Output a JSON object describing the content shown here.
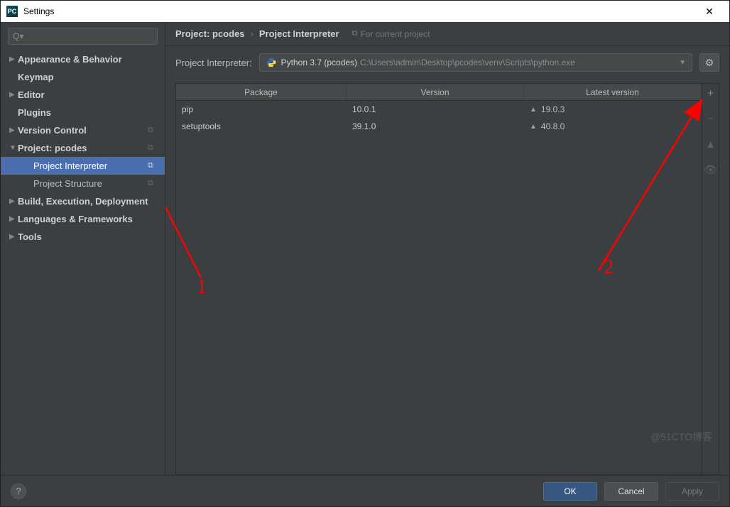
{
  "window_title": "Settings",
  "sidebar": {
    "search_placeholder": "",
    "items": [
      {
        "label": "Appearance & Behavior",
        "arrow": "▶",
        "bold": true
      },
      {
        "label": "Keymap",
        "arrow": "",
        "bold": true
      },
      {
        "label": "Editor",
        "arrow": "▶",
        "bold": true
      },
      {
        "label": "Plugins",
        "arrow": "",
        "bold": true
      },
      {
        "label": "Version Control",
        "arrow": "▶",
        "bold": true,
        "copy": true
      },
      {
        "label": "Project: pcodes",
        "arrow": "▼",
        "bold": true,
        "copy": true
      },
      {
        "label": "Project Interpreter",
        "child": true,
        "selected": true,
        "copy": true
      },
      {
        "label": "Project Structure",
        "child": true,
        "copy": true
      },
      {
        "label": "Build, Execution, Deployment",
        "arrow": "▶",
        "bold": true
      },
      {
        "label": "Languages & Frameworks",
        "arrow": "▶",
        "bold": true
      },
      {
        "label": "Tools",
        "arrow": "▶",
        "bold": true
      }
    ]
  },
  "breadcrumb": {
    "part1": "Project: pcodes",
    "part2": "Project Interpreter",
    "for_current": "For current project"
  },
  "interpreter": {
    "label": "Project Interpreter:",
    "name": "Python 3.7 (pcodes)",
    "path": "C:\\Users\\admin\\Desktop\\pcodes\\venv\\Scripts\\python.exe"
  },
  "table": {
    "headers": {
      "pkg": "Package",
      "ver": "Version",
      "lat": "Latest version"
    },
    "rows": [
      {
        "pkg": "pip",
        "ver": "10.0.1",
        "lat": "19.0.3",
        "upgrade": true
      },
      {
        "pkg": "setuptools",
        "ver": "39.1.0",
        "lat": "40.8.0",
        "upgrade": true
      }
    ]
  },
  "footer": {
    "ok": "OK",
    "cancel": "Cancel",
    "apply": "Apply"
  },
  "annotations": {
    "one": "1",
    "two": "2"
  },
  "watermark": "@51CTO博客",
  "icons": {
    "pc": "PC",
    "search": "🔍",
    "gear": "⚙",
    "plus": "+",
    "minus": "−",
    "up": "▲",
    "eye": "👁",
    "help": "?",
    "close": "✕",
    "copy": "⧉"
  }
}
